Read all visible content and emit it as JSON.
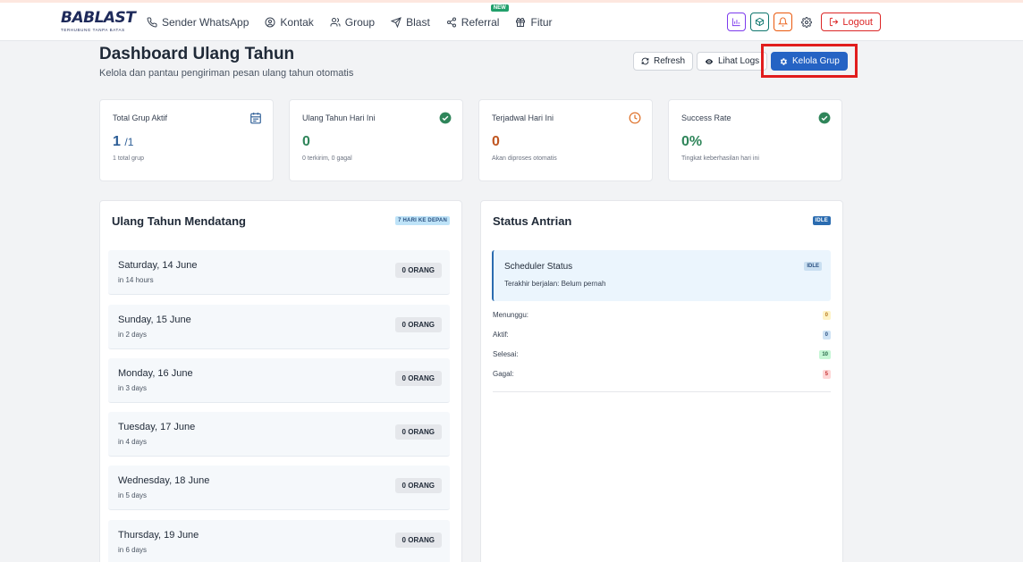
{
  "nav": {
    "logo_text": "BABLAST",
    "logo_tagline": "TERHUBUNG TANPA BATAS",
    "items": [
      {
        "label": "Sender WhatsApp",
        "icon": "phone-icon"
      },
      {
        "label": "Kontak",
        "icon": "contact-icon"
      },
      {
        "label": "Group",
        "icon": "group-icon"
      },
      {
        "label": "Blast",
        "icon": "send-icon"
      },
      {
        "label": "Referral",
        "icon": "share-icon",
        "badge": "NEW"
      },
      {
        "label": "Fitur",
        "icon": "gift-icon"
      }
    ],
    "logout_label": "Logout"
  },
  "header": {
    "title": "Dashboard Ulang Tahun",
    "subtitle": "Kelola dan pantau pengiriman pesan ulang tahun otomatis",
    "refresh_label": "Refresh",
    "logs_label": "Lihat Logs",
    "kelola_label": "Kelola Grup"
  },
  "stats": [
    {
      "label": "Total Grup Aktif",
      "value": "1",
      "value_suffix": "/1",
      "sub": "1 total grup",
      "color": "#2c5d96"
    },
    {
      "label": "Ulang Tahun Hari Ini",
      "value": "0",
      "sub": "0 terkirim, 0 gagal",
      "color": "#2f855a"
    },
    {
      "label": "Terjadwal Hari Ini",
      "value": "0",
      "sub": "Akan diproses otomatis",
      "color": "#c05621"
    },
    {
      "label": "Success Rate",
      "value": "0%",
      "sub": "Tingkat keberhasilan hari ini",
      "color": "#2f855a"
    }
  ],
  "upcoming": {
    "title": "Ulang Tahun Mendatang",
    "tag": "7 HARI KE DEPAN",
    "days": [
      {
        "name": "Saturday, 14 June",
        "relative": "in 14 hours",
        "count": "0 ORANG"
      },
      {
        "name": "Sunday, 15 June",
        "relative": "in 2 days",
        "count": "0 ORANG"
      },
      {
        "name": "Monday, 16 June",
        "relative": "in 3 days",
        "count": "0 ORANG"
      },
      {
        "name": "Tuesday, 17 June",
        "relative": "in 4 days",
        "count": "0 ORANG"
      },
      {
        "name": "Wednesday, 18 June",
        "relative": "in 5 days",
        "count": "0 ORANG"
      },
      {
        "name": "Thursday, 19 June",
        "relative": "in 6 days",
        "count": "0 ORANG"
      }
    ]
  },
  "queue": {
    "title": "Status Antrian",
    "tag": "IDLE",
    "scheduler_title": "Scheduler Status",
    "scheduler_tag": "IDLE",
    "scheduler_sub": "Terakhir berjalan: Belum pernah",
    "rows": [
      {
        "label": "Menunggu:",
        "value": "0"
      },
      {
        "label": "Aktif:",
        "value": "0"
      },
      {
        "label": "Selesai:",
        "value": "10"
      },
      {
        "label": "Gagal:",
        "value": "5"
      }
    ]
  }
}
